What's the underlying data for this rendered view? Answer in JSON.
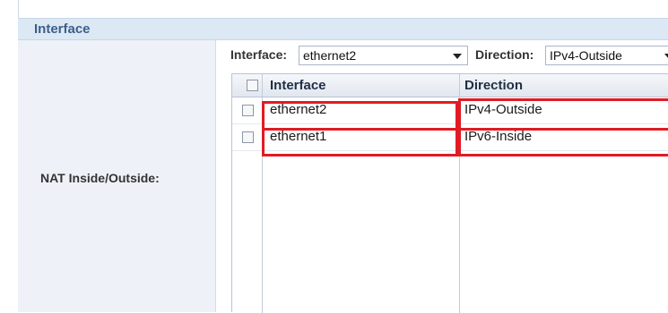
{
  "panel": {
    "title": "Interface"
  },
  "form": {
    "nat_label": "NAT Inside/Outside:"
  },
  "filters": {
    "interface_label": "Interface:",
    "interface_value": "ethernet2",
    "direction_label": "Direction:",
    "direction_value": "IPv4-Outside"
  },
  "table": {
    "columns": [
      "Interface",
      "Direction"
    ],
    "rows": [
      {
        "interface": "ethernet2",
        "direction": "IPv4-Outside",
        "checked": false,
        "highlighted": true
      },
      {
        "interface": "ethernet1",
        "direction": "IPv6-Inside",
        "checked": false,
        "highlighted": true
      }
    ]
  },
  "colors": {
    "highlight": "#e01b24",
    "header_title": "#3b5f8a"
  }
}
